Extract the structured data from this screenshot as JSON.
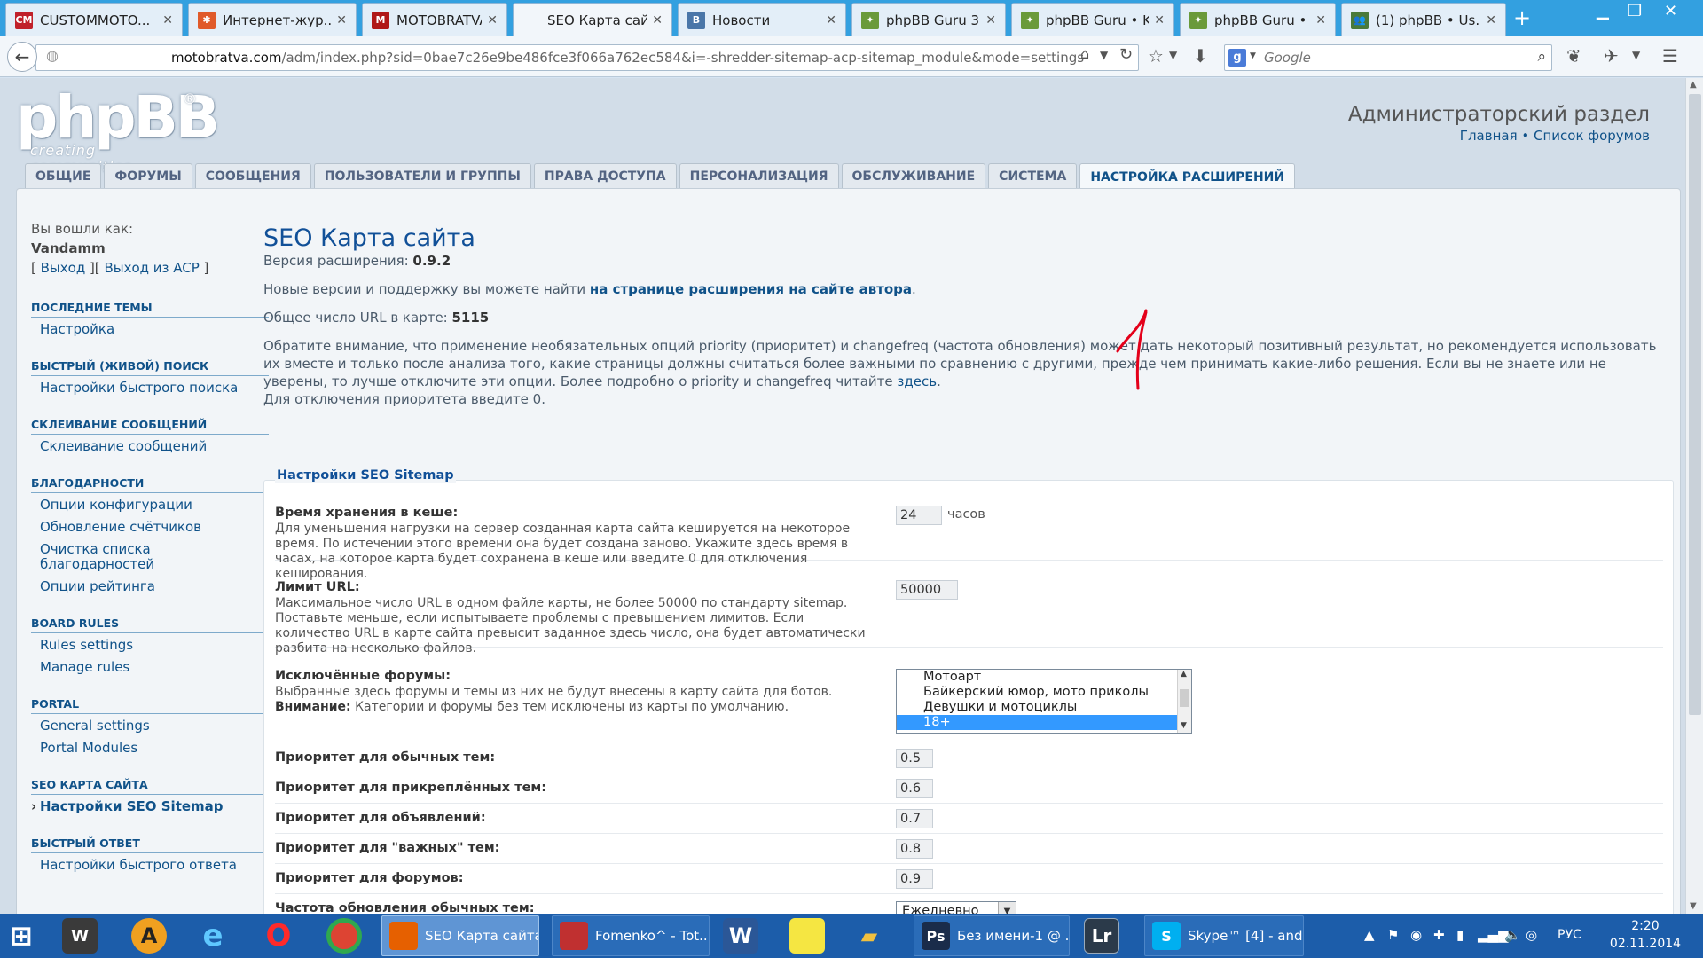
{
  "browser": {
    "tabs": [
      {
        "title": "CUSTOMMOTO...",
        "icon": "custommoto-icon",
        "color": "#c0202a",
        "glyph": "CM"
      },
      {
        "title": "Интернет-жур...",
        "icon": "joomla-icon",
        "color": "#e05a2a",
        "glyph": "✱"
      },
      {
        "title": "MOTOBRATVA....",
        "icon": "motobratva-icon",
        "color": "#b01818",
        "glyph": "M"
      },
      {
        "title": "SEO Карта сайта",
        "icon": "blank-page-icon",
        "color": "",
        "glyph": ""
      },
      {
        "title": "Новости",
        "icon": "vk-icon",
        "color": "#4a76a8",
        "glyph": "В"
      },
      {
        "title": "phpBB Guru 3.1...",
        "icon": "phpbb-guru-icon",
        "color": "#6a9a3a",
        "glyph": "✦"
      },
      {
        "title": "phpBB Guru • K...",
        "icon": "phpbb-guru-icon",
        "color": "#6a9a3a",
        "glyph": "✦"
      },
      {
        "title": "phpBB Guru • ...",
        "icon": "phpbb-guru-icon",
        "color": "#6a9a3a",
        "glyph": "✦"
      },
      {
        "title": "(1) phpBB • Us...",
        "icon": "users-icon",
        "color": "#4a7a3a",
        "glyph": "👥"
      }
    ],
    "url_host": "motobratva.com",
    "url_path": "/adm/index.php?sid=0bae7c26e9be486fce3f066a762ec584&i=-shredder-sitemap-acp-sitemap_module&mode=settings",
    "search_placeholder": "Google"
  },
  "header": {
    "logo_main": "phpBB",
    "logo_sub": "creating  communities",
    "logo_reg": "®",
    "acp_title": "Администраторский раздел",
    "link_home": "Главная",
    "link_sep": " • ",
    "link_forums": "Список форумов"
  },
  "tabs": [
    {
      "label": "ОБЩИЕ",
      "name": "tab-general"
    },
    {
      "label": "ФОРУМЫ",
      "name": "tab-forums"
    },
    {
      "label": "СООБЩЕНИЯ",
      "name": "tab-posts"
    },
    {
      "label": "ПОЛЬЗОВАТЕЛИ И ГРУППЫ",
      "name": "tab-users-groups"
    },
    {
      "label": "ПРАВА ДОСТУПА",
      "name": "tab-permissions"
    },
    {
      "label": "ПЕРСОНАЛИЗАЦИЯ",
      "name": "tab-customise"
    },
    {
      "label": "ОБСЛУЖИВАНИЕ",
      "name": "tab-maintenance"
    },
    {
      "label": "СИСТЕМА",
      "name": "tab-system"
    },
    {
      "label": "НАСТРОЙКА РАСШИРЕНИЙ",
      "name": "tab-extensions",
      "active": true
    }
  ],
  "sidebar": {
    "logged_in_as": "Вы вошли как:",
    "username": "Vandamm",
    "logout_open": "[ ",
    "logout": "Выход",
    "logout_mid": " ][ ",
    "logout_acp": "Выход из ACP",
    "logout_close": " ]",
    "sections": [
      {
        "title": "ПОСЛЕДНИЕ ТЕМЫ",
        "items": [
          {
            "label": "Настройка"
          }
        ]
      },
      {
        "title": "БЫСТРЫЙ (ЖИВОЙ) ПОИСК",
        "items": [
          {
            "label": "Настройки быстрого поиска"
          }
        ]
      },
      {
        "title": "СКЛЕИВАНИЕ СООБЩЕНИЙ",
        "items": [
          {
            "label": "Склеивание сообщений"
          }
        ]
      },
      {
        "title": "БЛАГОДАРНОСТИ",
        "items": [
          {
            "label": "Опции конфигурации"
          },
          {
            "label": "Обновление счётчиков"
          },
          {
            "label": "Очистка списка благодарностей"
          },
          {
            "label": "Опции рейтинга"
          }
        ]
      },
      {
        "title": "BOARD RULES",
        "items": [
          {
            "label": "Rules settings"
          },
          {
            "label": "Manage rules"
          }
        ]
      },
      {
        "title": "PORTAL",
        "items": [
          {
            "label": "General settings"
          },
          {
            "label": "Portal Modules"
          }
        ]
      },
      {
        "title": "SEO КАРТА САЙТА",
        "items": [
          {
            "label": "Настройки SEO Sitemap",
            "current": true
          }
        ]
      },
      {
        "title": "БЫСТРЫЙ ОТВЕТ",
        "items": [
          {
            "label": "Настройки быстрого ответа"
          }
        ]
      }
    ]
  },
  "main": {
    "title": "SEO Карта сайта",
    "version_label": "Версия расширения: ",
    "version": "0.9.2",
    "newver_text": "Новые версии и поддержку вы можете найти ",
    "newver_link": "на странице расширения на сайте автора",
    "newver_end": ".",
    "url_count_label": "Общее число URL в карте: ",
    "url_count": "5115",
    "notice": "Обратите внимание, что применение необязательных опций priority (приоритет) и changefreq (частота обновления) может дать некоторый позитивный результат, но рекомендуется использовать их вместе и только после анализа того, какие страницы должны считаться более важными по сравнению с другими, прежде чем принимать какие-либо решения. Если вы не знаете или не уверены, то лучше отключите эти опции. Более подробно о priority и changefreq читайте ",
    "notice_link": "здесь",
    "notice_end": ".",
    "notice_2": "Для отключения приоритета введите 0.",
    "fieldset_title": "Настройки SEO Sitemap",
    "settings": {
      "cache": {
        "label": "Время хранения в кеше:",
        "desc": "Для уменьшения нагрузки на сервер созданная карта сайта кешируется на некоторое время. По истечении этого времени она будет создана заново. Укажите здесь время в часах, на которое карта будет сохранена в кеше или введите 0 для отключения кеширования.",
        "value": "24",
        "unit": "часов"
      },
      "url_limit": {
        "label": "Лимит URL:",
        "desc": "Максимальное число URL в одном файле карты, не более 50000 по стандарту sitemap. Поставьте меньше, если испытываете проблемы с превышением лимитов. Если количество URL в карте сайта превысит заданное здесь число, она будет автоматически разбита на несколько файлов.",
        "value": "50000"
      },
      "excluded": {
        "label": "Исключённые форумы:",
        "desc": "Выбранные здесь форумы и темы из них не будут внесены в карту сайта для ботов.",
        "warn_label": "Внимание:",
        "warn": " Категории и форумы без тем исключены из карты по умолчанию.",
        "options": [
          "Мотоарт",
          "Байкерский юмор, мото приколы",
          "Девушки и мотоциклы",
          "18+"
        ],
        "selected": "18+"
      },
      "prio_normal": {
        "label": "Приоритет для обычных тем:",
        "value": "0.5"
      },
      "prio_sticky": {
        "label": "Приоритет для прикреплённых тем:",
        "value": "0.6"
      },
      "prio_announce": {
        "label": "Приоритет для объявлений:",
        "value": "0.7"
      },
      "prio_global": {
        "label": "Приоритет для \"важных\" тем:",
        "value": "0.8"
      },
      "prio_forums": {
        "label": "Приоритет для форумов:",
        "value": "0.9"
      },
      "freq_normal": {
        "label": "Частота обновления обычных тем:",
        "value": "Ежедневно"
      }
    }
  },
  "taskbar": {
    "windows": [
      {
        "title": "SEO Карта сайта...",
        "icon": "firefox-icon",
        "color": "#e66000",
        "active": true
      },
      {
        "title": "Fomenko^ - Tot...",
        "icon": "total-commander-icon",
        "color": "#c03030"
      },
      {
        "title": "Без имени-1 @ ...",
        "icon": "photoshop-icon",
        "color": "#1a2c4a",
        "glyph": "Ps"
      },
      {
        "title": "Skype™ [4] - and...",
        "icon": "skype-icon",
        "color": "#00aff0",
        "glyph": "S"
      }
    ],
    "lang": "РУС",
    "time": "2:20",
    "date": "02.11.2014"
  }
}
